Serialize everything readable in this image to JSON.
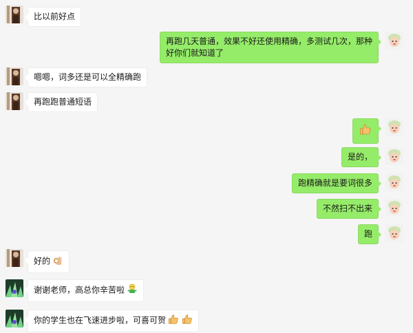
{
  "colors": {
    "background": "#f5f5f5",
    "sent_bubble": "#95ec69",
    "received_bubble": "#ffffff"
  },
  "messages": [
    {
      "side": "left",
      "avatar": "teacher-avatar",
      "text": "比以前好点"
    },
    {
      "side": "right",
      "avatar": "baby-avatar",
      "text": "再跑几天普通，效果不好还使用精确，多测试几次，那种好你们就知道了"
    },
    {
      "side": "left",
      "avatar": "teacher-avatar",
      "text": "嗯嗯，词多还是可以全精确跑"
    },
    {
      "side": "left",
      "avatar": "teacher-avatar",
      "text": "再跑跑普通短语"
    },
    {
      "side": "right",
      "avatar": "baby-avatar",
      "text": "",
      "emoji": [
        "thumbs-up-icon"
      ]
    },
    {
      "side": "right",
      "avatar": "baby-avatar",
      "text": "是的，"
    },
    {
      "side": "right",
      "avatar": "baby-avatar",
      "text": "跑精确就是要词很多"
    },
    {
      "side": "right",
      "avatar": "baby-avatar",
      "text": "不然扫不出来"
    },
    {
      "side": "right",
      "avatar": "baby-avatar",
      "text": "跑"
    },
    {
      "side": "left",
      "avatar": "teacher-avatar",
      "text": "好的",
      "emoji": [
        "ok-hand-icon"
      ]
    },
    {
      "side": "left",
      "avatar": "stage-avatar",
      "text": "谢谢老师，高总你辛苦啦",
      "emoji": [
        "hardworking-figure-icon"
      ]
    },
    {
      "side": "left",
      "avatar": "stage-avatar",
      "text": "你的学生也在飞速进步啦，可喜可贺",
      "emoji": [
        "thumbs-up-icon",
        "thumbs-up-icon"
      ]
    }
  ]
}
